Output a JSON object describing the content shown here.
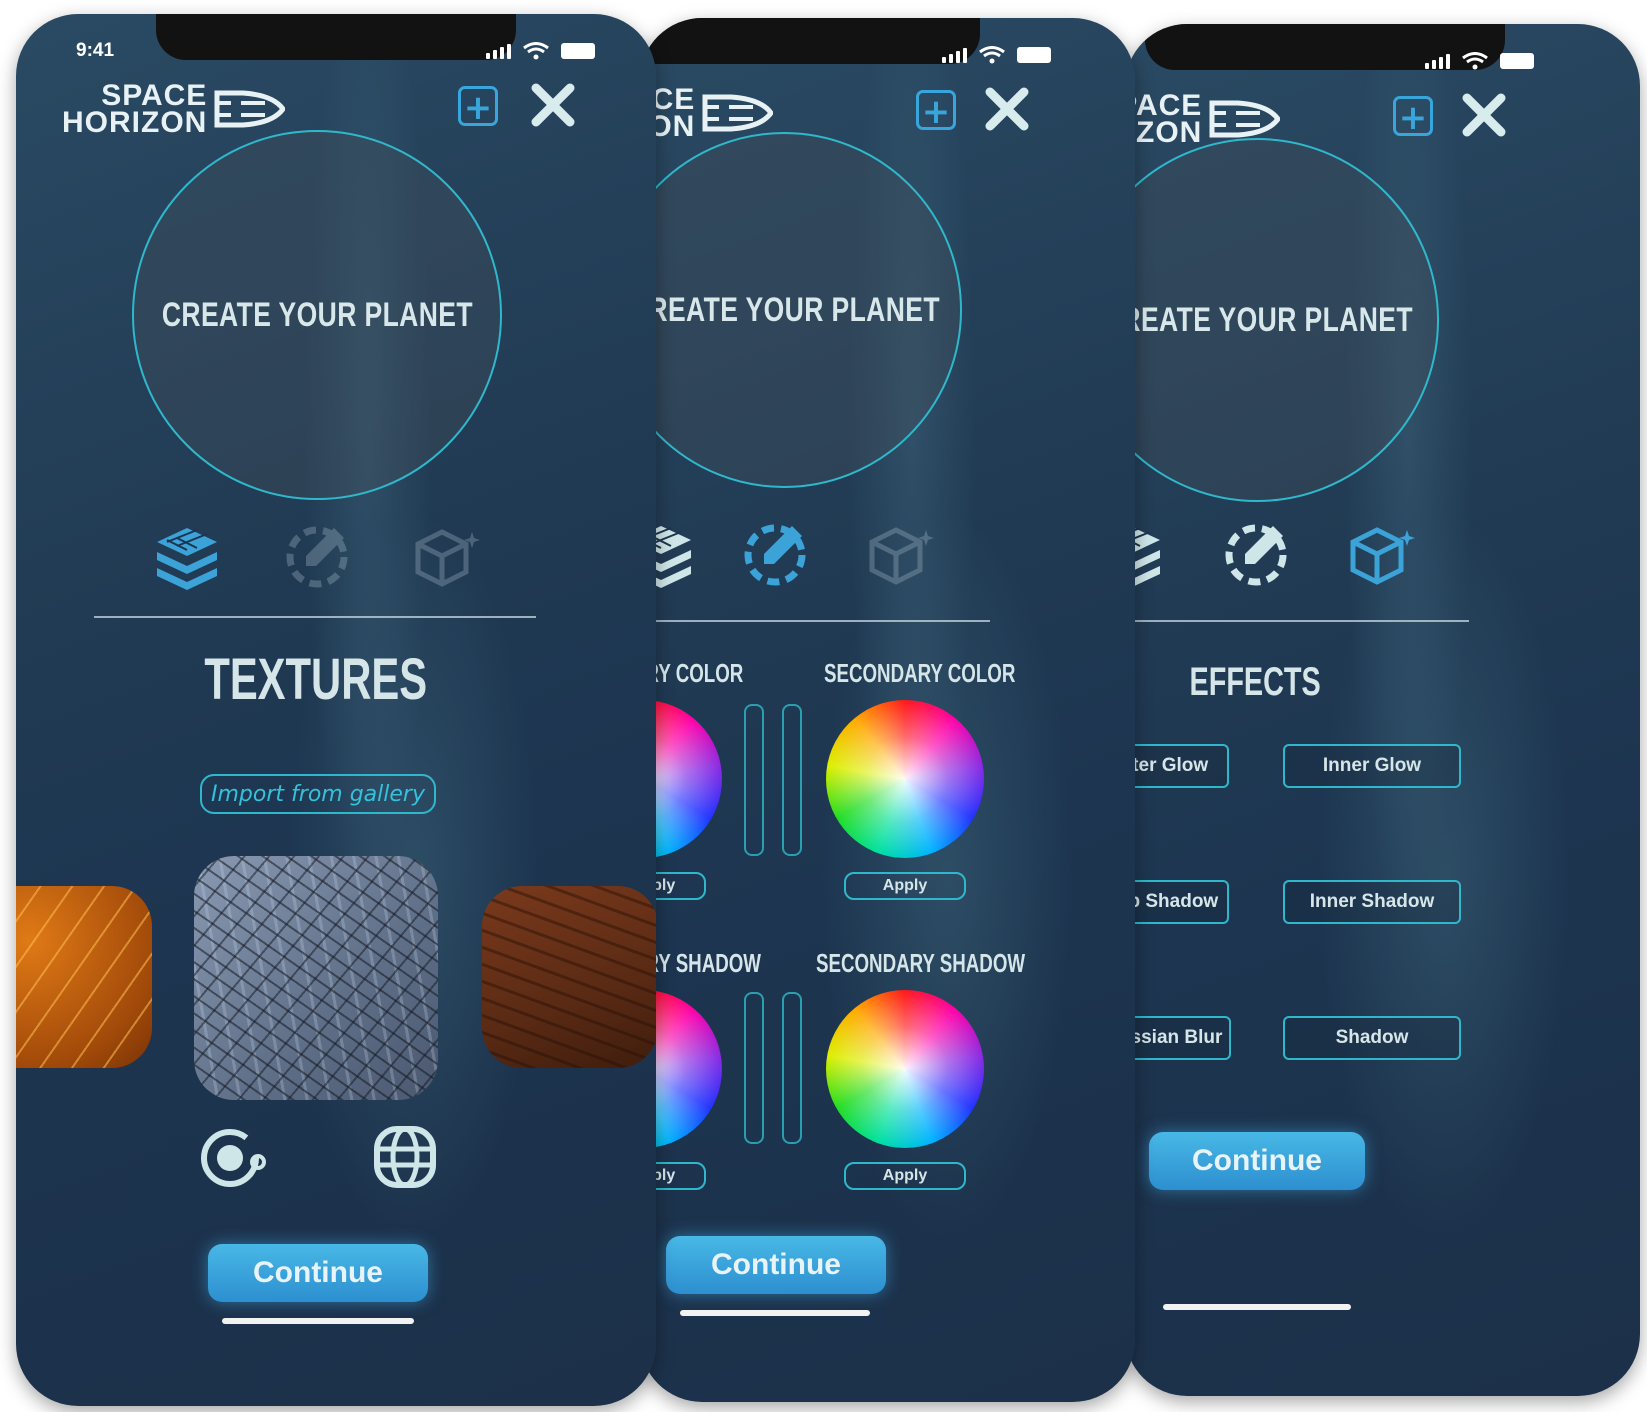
{
  "status_bar": {
    "time": "9:41"
  },
  "brand": {
    "line1": "SPACE",
    "line2": "HORIZON"
  },
  "screens": [
    {
      "planet_prompt": "CREATE YOUR PLANET",
      "section_title": "TEXTURES",
      "import_label": "Import from gallery",
      "continue_label": "Continue"
    },
    {
      "planet_prompt": "CREATE YOUR PLANET",
      "primary_color_label": "ARY COLOR",
      "secondary_color_label": "SECONDARY COLOR",
      "primary_shadow_label": "ARY SHADOW",
      "secondary_shadow_label": "SECONDARY SHADOW",
      "apply_label": "Apply",
      "continue_label": "Continue"
    },
    {
      "planet_prompt": "CREATE YOUR PLANET",
      "section_title": "EFFECTS",
      "effects": [
        "Outer Glow",
        "Inner Glow",
        "Drop Shadow",
        "Inner Shadow",
        "Gaussian Blur",
        "Shadow"
      ],
      "continue_label": "Continue"
    }
  ],
  "colors": {
    "accent": "#2fb8cc",
    "button": "#38a6dc",
    "background": "#223c55"
  },
  "icons": [
    "textures-icon",
    "color-picker-icon",
    "effects-cube-icon",
    "plus-icon",
    "close-icon",
    "orbit-icon",
    "globe-icon"
  ]
}
